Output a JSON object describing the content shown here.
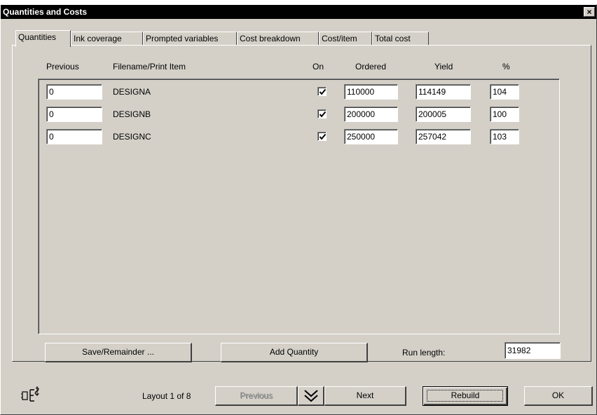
{
  "window": {
    "title": "Quantities and Costs",
    "close_label": "×"
  },
  "tabs": [
    {
      "label": "Quantities",
      "active": true
    },
    {
      "label": "Ink coverage"
    },
    {
      "label": "Prompted variables"
    },
    {
      "label": "Cost breakdown"
    },
    {
      "label": "Cost/item"
    },
    {
      "label": "Total cost"
    }
  ],
  "columns": {
    "previous": "Previous",
    "filename": "Filename/Print Item",
    "on": "On",
    "ordered": "Ordered",
    "yield": "Yield",
    "percent": "%"
  },
  "rows": [
    {
      "previous": "0",
      "filename": "DESIGNA",
      "on": true,
      "ordered": "110000",
      "yield": "114149",
      "percent": "104"
    },
    {
      "previous": "0",
      "filename": "DESIGNB",
      "on": true,
      "ordered": "200000",
      "yield": "200005",
      "percent": "100"
    },
    {
      "previous": "0",
      "filename": "DESIGNC",
      "on": true,
      "ordered": "250000",
      "yield": "257042",
      "percent": "103"
    }
  ],
  "actions": {
    "save_remainder": "Save/Remainder ...",
    "add_quantity": "Add Quantity",
    "run_length_label": "Run length:",
    "run_length_value": "31982"
  },
  "footer": {
    "layout_label": "Layout 1 of 8",
    "previous": "Previous",
    "next": "Next",
    "rebuild": "Rebuild",
    "ok": "OK"
  },
  "icons": {
    "calculator": "calculator-icon",
    "dropdown": "double-chevron-down-icon",
    "check": "checkmark-icon"
  }
}
